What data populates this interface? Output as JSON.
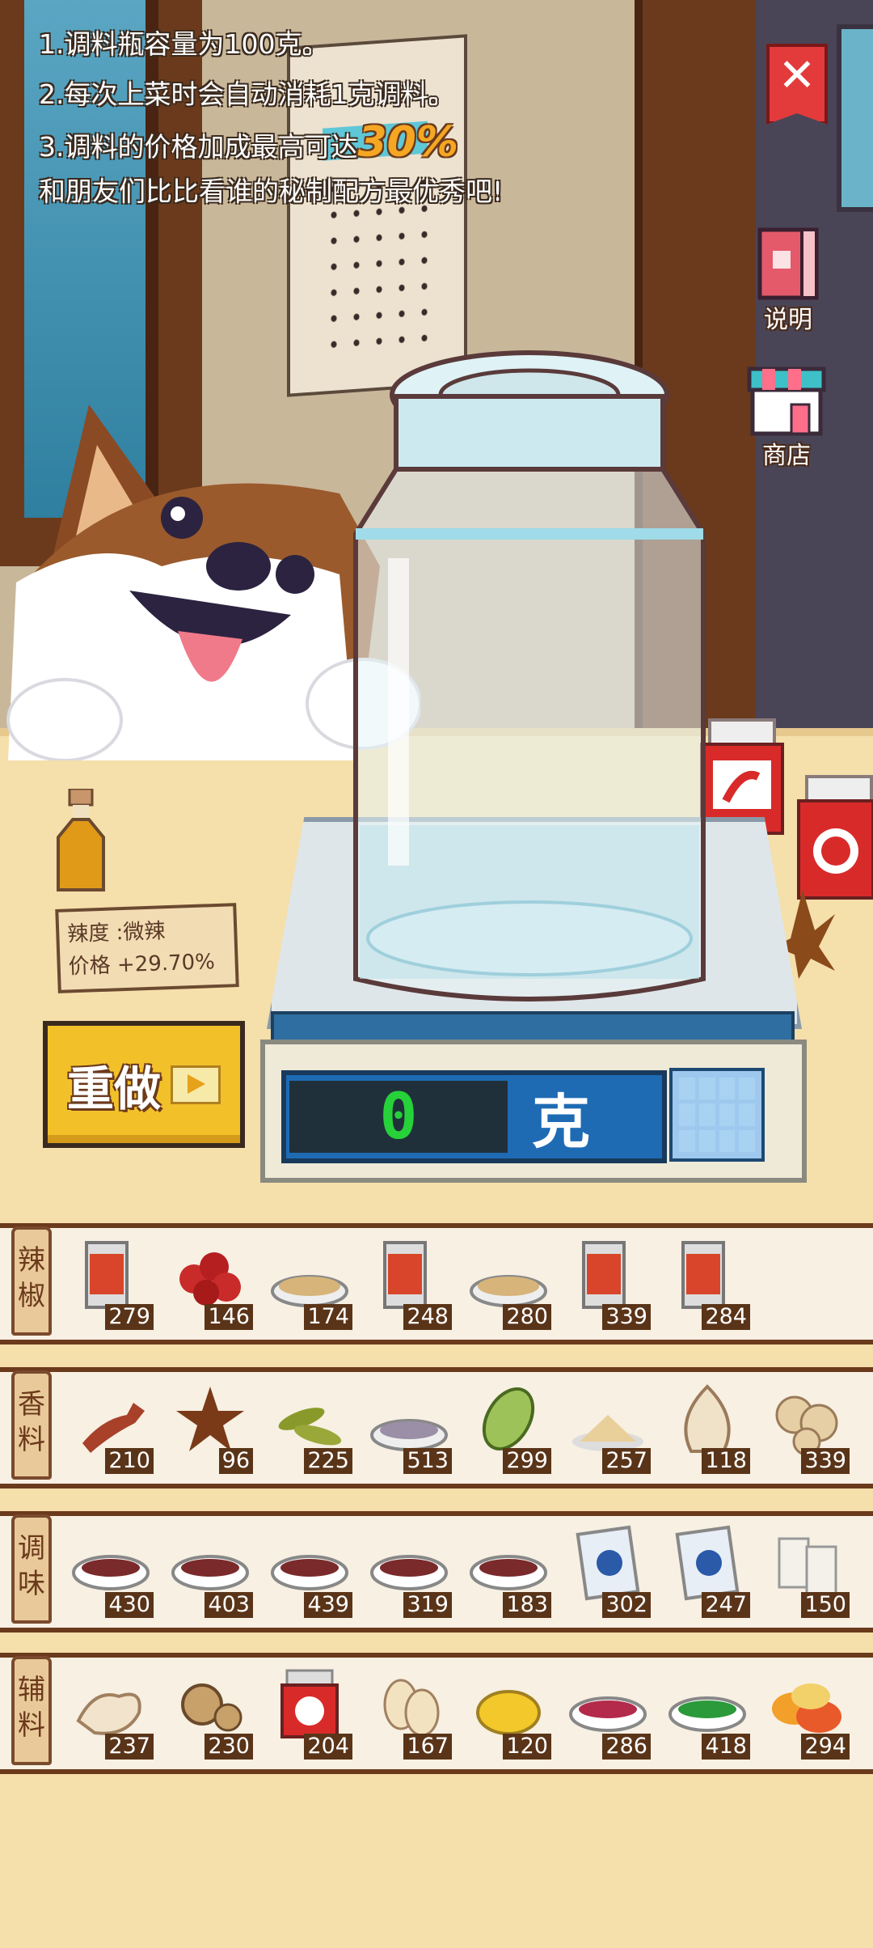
{
  "info": {
    "line1": "1.调料瓶容量为100克。",
    "line2": "2.每次上菜时会自动消耗1克调料。",
    "line3_prefix": "3.调料的价格加成最高可达",
    "line3_highlight": "30%",
    "line4": "和朋友们比比看谁的秘制配方最优秀吧!"
  },
  "buttons": {
    "close": "✕",
    "help": "说明",
    "shop": "商店",
    "redo": "重做"
  },
  "spice_info": {
    "level": "辣度 :微辣",
    "price": "价格 +29.70%"
  },
  "scale": {
    "value": "0",
    "unit": "克"
  },
  "shelves": [
    {
      "category": "辣\n椒",
      "items": [
        {
          "icon": "chili-can-icon",
          "count": "279"
        },
        {
          "icon": "sichuan-pepper-icon",
          "count": "146"
        },
        {
          "icon": "chili-powder-bowl-icon",
          "count": "174"
        },
        {
          "icon": "chili-can-icon",
          "count": "248"
        },
        {
          "icon": "chili-powder-bowl-icon",
          "count": "280"
        },
        {
          "icon": "chili-can-icon",
          "count": "339"
        },
        {
          "icon": "chili-can-icon",
          "count": "284"
        }
      ]
    },
    {
      "category": "香\n料",
      "items": [
        {
          "icon": "clove-icon",
          "count": "210"
        },
        {
          "icon": "star-anise-icon",
          "count": "96"
        },
        {
          "icon": "green-pod-icon",
          "count": "225"
        },
        {
          "icon": "powder-bowl-icon",
          "count": "513"
        },
        {
          "icon": "cardamom-icon",
          "count": "299"
        },
        {
          "icon": "powder-pile-icon",
          "count": "257"
        },
        {
          "icon": "garlic-icon",
          "count": "118"
        },
        {
          "icon": "nutmeg-icon",
          "count": "339"
        }
      ]
    },
    {
      "category": "调\n味",
      "items": [
        {
          "icon": "sauce-bowl-icon",
          "count": "430"
        },
        {
          "icon": "sauce-bowl-icon",
          "count": "403"
        },
        {
          "icon": "sauce-bowl-icon",
          "count": "439"
        },
        {
          "icon": "sauce-bowl-icon",
          "count": "319"
        },
        {
          "icon": "sauce-bowl-icon",
          "count": "183"
        },
        {
          "icon": "packet-icon",
          "count": "302"
        },
        {
          "icon": "packet-icon",
          "count": "247"
        },
        {
          "icon": "sugar-cube-icon",
          "count": "150"
        }
      ]
    },
    {
      "category": "辅\n料",
      "items": [
        {
          "icon": "ginger-icon",
          "count": "237"
        },
        {
          "icon": "walnut-icon",
          "count": "230"
        },
        {
          "icon": "tomato-jar-icon",
          "count": "204"
        },
        {
          "icon": "peanut-icon",
          "count": "167"
        },
        {
          "icon": "lemon-icon",
          "count": "120"
        },
        {
          "icon": "berry-bowl-icon",
          "count": "286"
        },
        {
          "icon": "herb-bowl-icon",
          "count": "418"
        },
        {
          "icon": "nut-mix-icon",
          "count": "294"
        }
      ]
    }
  ],
  "colors": {
    "accent": "#f5a623",
    "counter": "#f5dfab",
    "shelf_border": "#6b3a1c",
    "display_digits": "#27d13a"
  }
}
